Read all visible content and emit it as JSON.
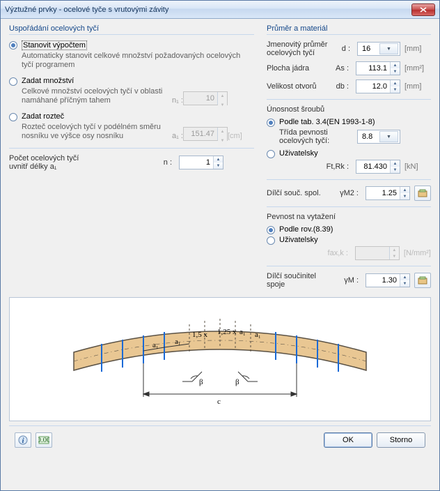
{
  "window": {
    "title": "Výztužné prvky - ocelové tyče s vrutovými závity"
  },
  "left": {
    "group_title": "Uspořádání ocelových tyčí",
    "opt_calc": {
      "label": "Stanovit výpočtem",
      "desc": "Automaticky stanovit celkové množství požadovaných ocelových tyčí programem"
    },
    "opt_qty": {
      "label": "Zadat množství",
      "desc": "Celkové množství ocelových tyčí v oblasti namáhané příčným tahem",
      "sym": "n₁ :",
      "value": "10",
      "unit": ""
    },
    "opt_spc": {
      "label": "Zadat rozteč",
      "desc": "Rozteč ocelových tyčí v podélném směru nosníku ve výšce osy nosníku",
      "sym": "a₁ :",
      "value": "151.47",
      "unit": "[cm]"
    },
    "count": {
      "label": "Počet ocelových tyčí\nuvnitř délky a₁",
      "sym": "n :",
      "value": "1"
    }
  },
  "right": {
    "group_title": "Průměr a materiál",
    "diam": {
      "label": "Jmenovitý průměr\nocelových tyčí",
      "sym": "d :",
      "value": "16",
      "unit": "[mm]"
    },
    "area": {
      "label": "Plocha jádra",
      "sym": "As :",
      "value": "113.1",
      "unit": "[mm²]"
    },
    "hole": {
      "label": "Velikost otvorů",
      "sym": "db :",
      "value": "12.0",
      "unit": "[mm]"
    },
    "bolt_group": "Únosnost šroubů",
    "bolt_opt1": "Podle tab. 3.4(EN 1993-1-8)",
    "bolt_class": {
      "label": "Třída pevnosti\nocelových tyčí:",
      "value": "8.8"
    },
    "bolt_opt2": "Uživatelsky",
    "ftrk": {
      "sym": "Ft,Rk :",
      "value": "81.430",
      "unit": "[kN]"
    },
    "psf": {
      "label": "Dílčí souč. spol.",
      "sym": "γM2 :",
      "value": "1.25"
    },
    "pull_group": "Pevnost na vytažení",
    "pull_opt1": "Podle rov.(8.39)",
    "pull_opt2": "Uživatelsky",
    "faxk": {
      "sym": "fax,k :",
      "value": "",
      "unit": "[N/mm²]"
    },
    "psf2": {
      "label": "Dílčí součinitel\nspoje",
      "sym": "γM :",
      "value": "1.30"
    }
  },
  "diagram": {
    "a1": "a₁",
    "mult15": "1,5 x",
    "mult125": "1,25 x",
    "beta": "β",
    "c": "c"
  },
  "footer": {
    "ok": "OK",
    "cancel": "Storno"
  }
}
